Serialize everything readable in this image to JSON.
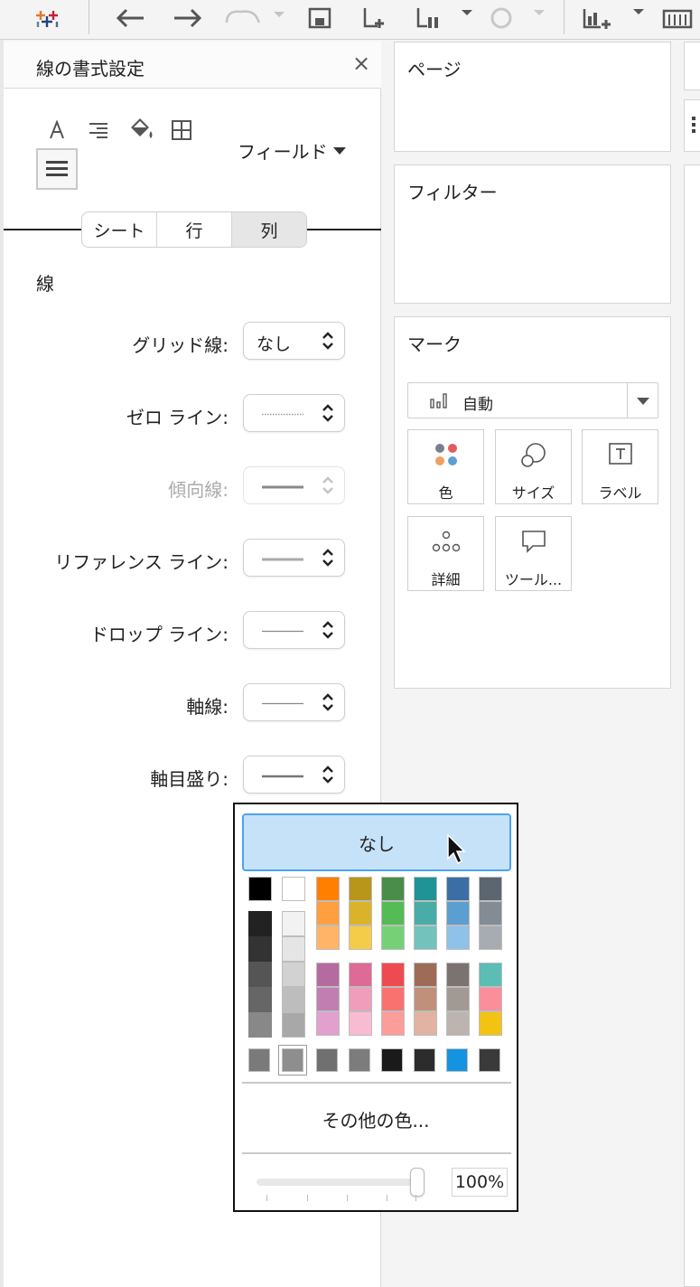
{
  "format_panel": {
    "title": "線の書式設定",
    "close_glyph": "×",
    "field_dropdown": "フィールド",
    "tabs": [
      "シート",
      "行",
      "列"
    ],
    "section_title": "線",
    "rows": [
      {
        "label": "グリッド線:",
        "value": "なし",
        "line": "none",
        "enabled": true
      },
      {
        "label": "ゼロ ライン:",
        "value": "",
        "line": "dotted",
        "enabled": true
      },
      {
        "label": "傾向線:",
        "value": "",
        "line": "solid-thick",
        "enabled": false
      },
      {
        "label": "リファレンス ライン:",
        "value": "",
        "line": "solid-gray",
        "enabled": true
      },
      {
        "label": "ドロップ ライン:",
        "value": "",
        "line": "solid-thin",
        "enabled": true
      },
      {
        "label": "軸線:",
        "value": "",
        "line": "solid-thin",
        "enabled": true
      },
      {
        "label": "軸目盛り:",
        "value": "",
        "line": "solid-medium",
        "enabled": true
      }
    ]
  },
  "shelves": {
    "pages_title": "ページ",
    "filters_title": "フィルター",
    "marks_title": "マーク",
    "mark_type": "自動",
    "buttons": [
      {
        "label": "色",
        "icon": "color-dots-icon"
      },
      {
        "label": "サイズ",
        "icon": "size-circles-icon"
      },
      {
        "label": "ラベル",
        "icon": "label-text-icon"
      },
      {
        "label": "詳細",
        "icon": "detail-dots-icon"
      },
      {
        "label": "ツール...",
        "icon": "tooltip-icon"
      }
    ]
  },
  "color_popup": {
    "none_label": "なし",
    "more_colors_label": "その他の色...",
    "opacity_value": "100%",
    "opacity_level": 1.0,
    "colors": {
      "top_row": [
        "#000000",
        "#ffffff",
        "#ff8000",
        "#b8961a",
        "#4a8c4a",
        "#1f9496",
        "#3b6ea5",
        "#5b6670"
      ],
      "gray_dark": [
        "#222222",
        "#333333",
        "#555555",
        "#666666",
        "#888888"
      ],
      "gray_light": [
        "#f2f2f2",
        "#e5e5e5",
        "#d2d2d2",
        "#bdbdbd",
        "#a8a8a8"
      ],
      "columns_top": [
        [
          "#ff9f40",
          "#ffb468"
        ],
        [
          "#dbb32b",
          "#f5cc4a"
        ],
        [
          "#55bb55",
          "#76d176"
        ],
        [
          "#4aaca6",
          "#73c2bc"
        ],
        [
          "#5b9fd0",
          "#8ec2e8"
        ],
        [
          "#838b95",
          "#a6acb2"
        ]
      ],
      "columns_bottom": [
        [
          "#b56b9f",
          "#c07fb0",
          "#e2a0cf"
        ],
        [
          "#de6b95",
          "#ef9dba",
          "#f8bcd2"
        ],
        [
          "#ee4b51",
          "#fa7270",
          "#fd9d99"
        ],
        [
          "#9e6b57",
          "#c0907a",
          "#e2b3a3"
        ],
        [
          "#7a7370",
          "#a19994",
          "#bdb4b0"
        ],
        [
          "#5bbdb4",
          "#fa8f9b",
          "#f3c313"
        ]
      ],
      "bottom_row": [
        "#7a7a7a",
        "#8e8e8e",
        "#707070",
        "#7c7c7c",
        "#1a1a1a",
        "#2c2c2c",
        "#1493e0",
        "#3a3a3a"
      ]
    }
  }
}
